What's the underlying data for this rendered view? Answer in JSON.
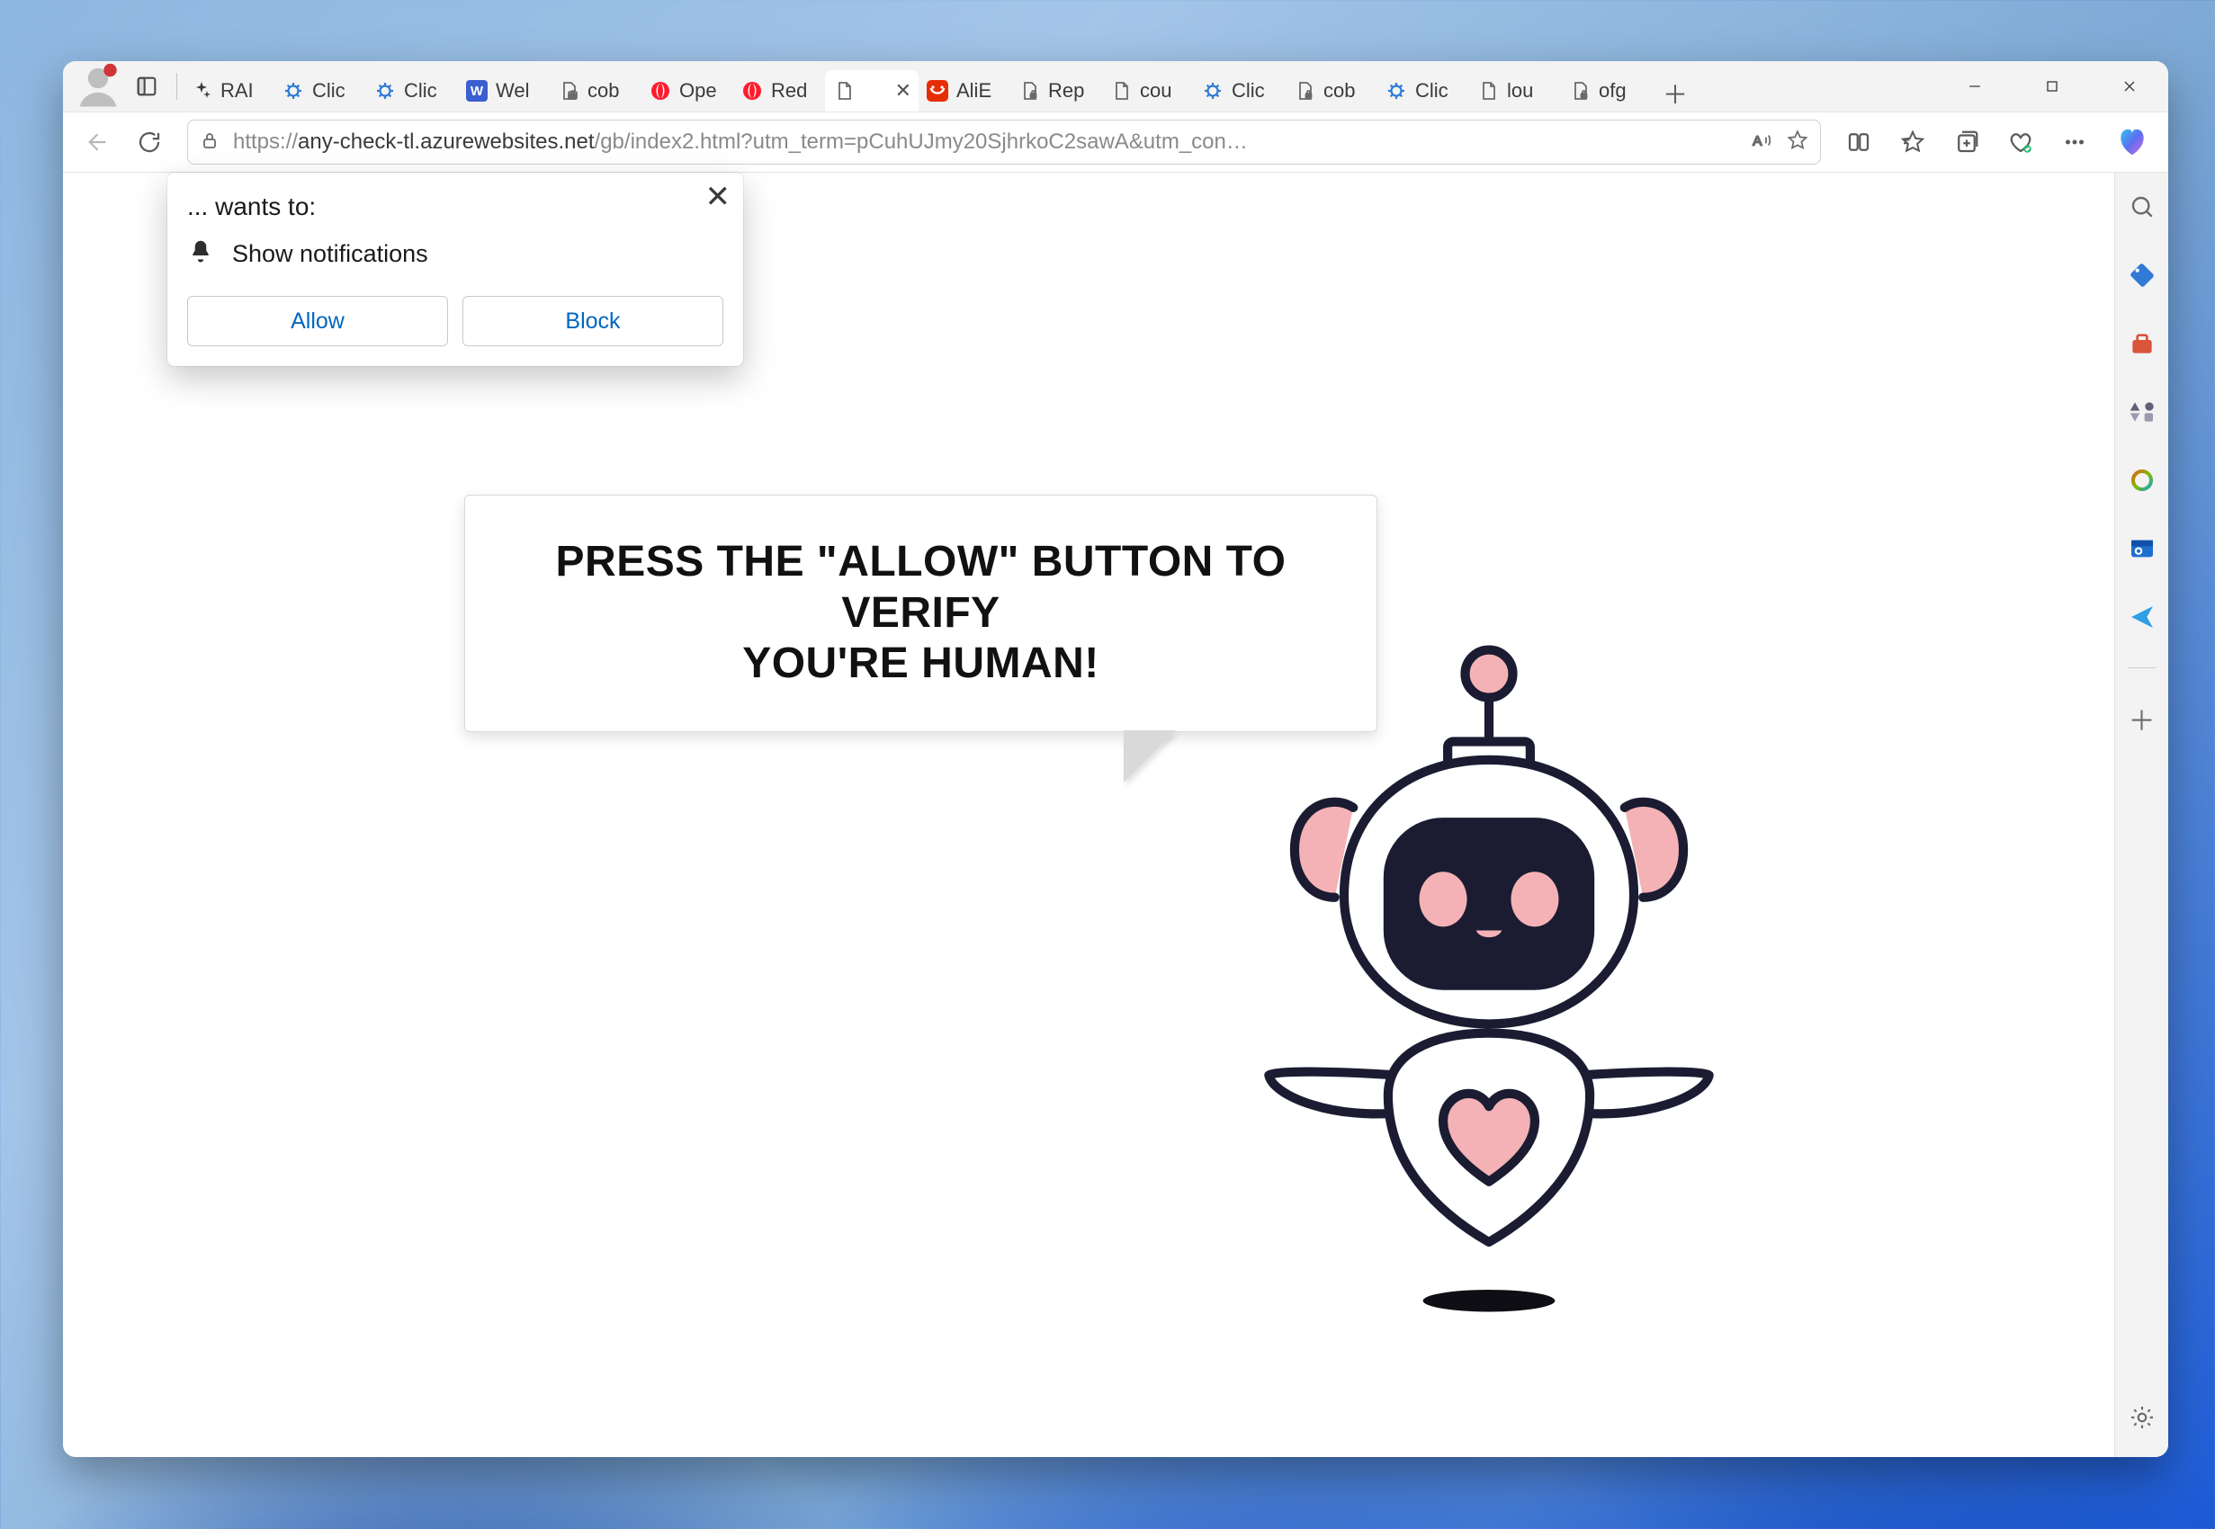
{
  "window": {
    "minimize": "Minimize",
    "maximize": "Maximize",
    "close": "Close"
  },
  "tabs": [
    {
      "label": "RAI",
      "icon": "sparkle"
    },
    {
      "label": "Clic",
      "icon": "gear-blue"
    },
    {
      "label": "Clic",
      "icon": "gear-blue"
    },
    {
      "label": "Wel",
      "icon": "w-square"
    },
    {
      "label": "cob",
      "icon": "file-lock"
    },
    {
      "label": "Ope",
      "icon": "opera"
    },
    {
      "label": "Red",
      "icon": "opera"
    },
    {
      "label": "",
      "icon": "file",
      "active": true
    },
    {
      "label": "AliE",
      "icon": "ali-red"
    },
    {
      "label": "Rep",
      "icon": "file-lock"
    },
    {
      "label": "cou",
      "icon": "file"
    },
    {
      "label": "Clic",
      "icon": "gear-blue"
    },
    {
      "label": "cob",
      "icon": "file-lock"
    },
    {
      "label": "Clic",
      "icon": "gear-blue"
    },
    {
      "label": "lou",
      "icon": "file"
    },
    {
      "label": "ofg",
      "icon": "file-lock"
    }
  ],
  "newtab_tooltip": "New tab",
  "url": {
    "scheme": "https://",
    "host": "any-check-tl.azurewebsites.net",
    "rest": "/gb/index2.html?utm_term=pCuhUJmy20SjhrkoC2sawA&utm_con…"
  },
  "permission": {
    "title": "... wants to:",
    "item": "Show notifications",
    "allow": "Allow",
    "block": "Block"
  },
  "page": {
    "headline_l1": "PRESS THE \"ALLOW\" BUTTON TO VERIFY",
    "headline_l2": "YOU'RE HUMAN!"
  },
  "sidepanel": {
    "items": [
      "search",
      "tag",
      "briefcase",
      "games",
      "copilot-color",
      "outlook",
      "send"
    ]
  }
}
